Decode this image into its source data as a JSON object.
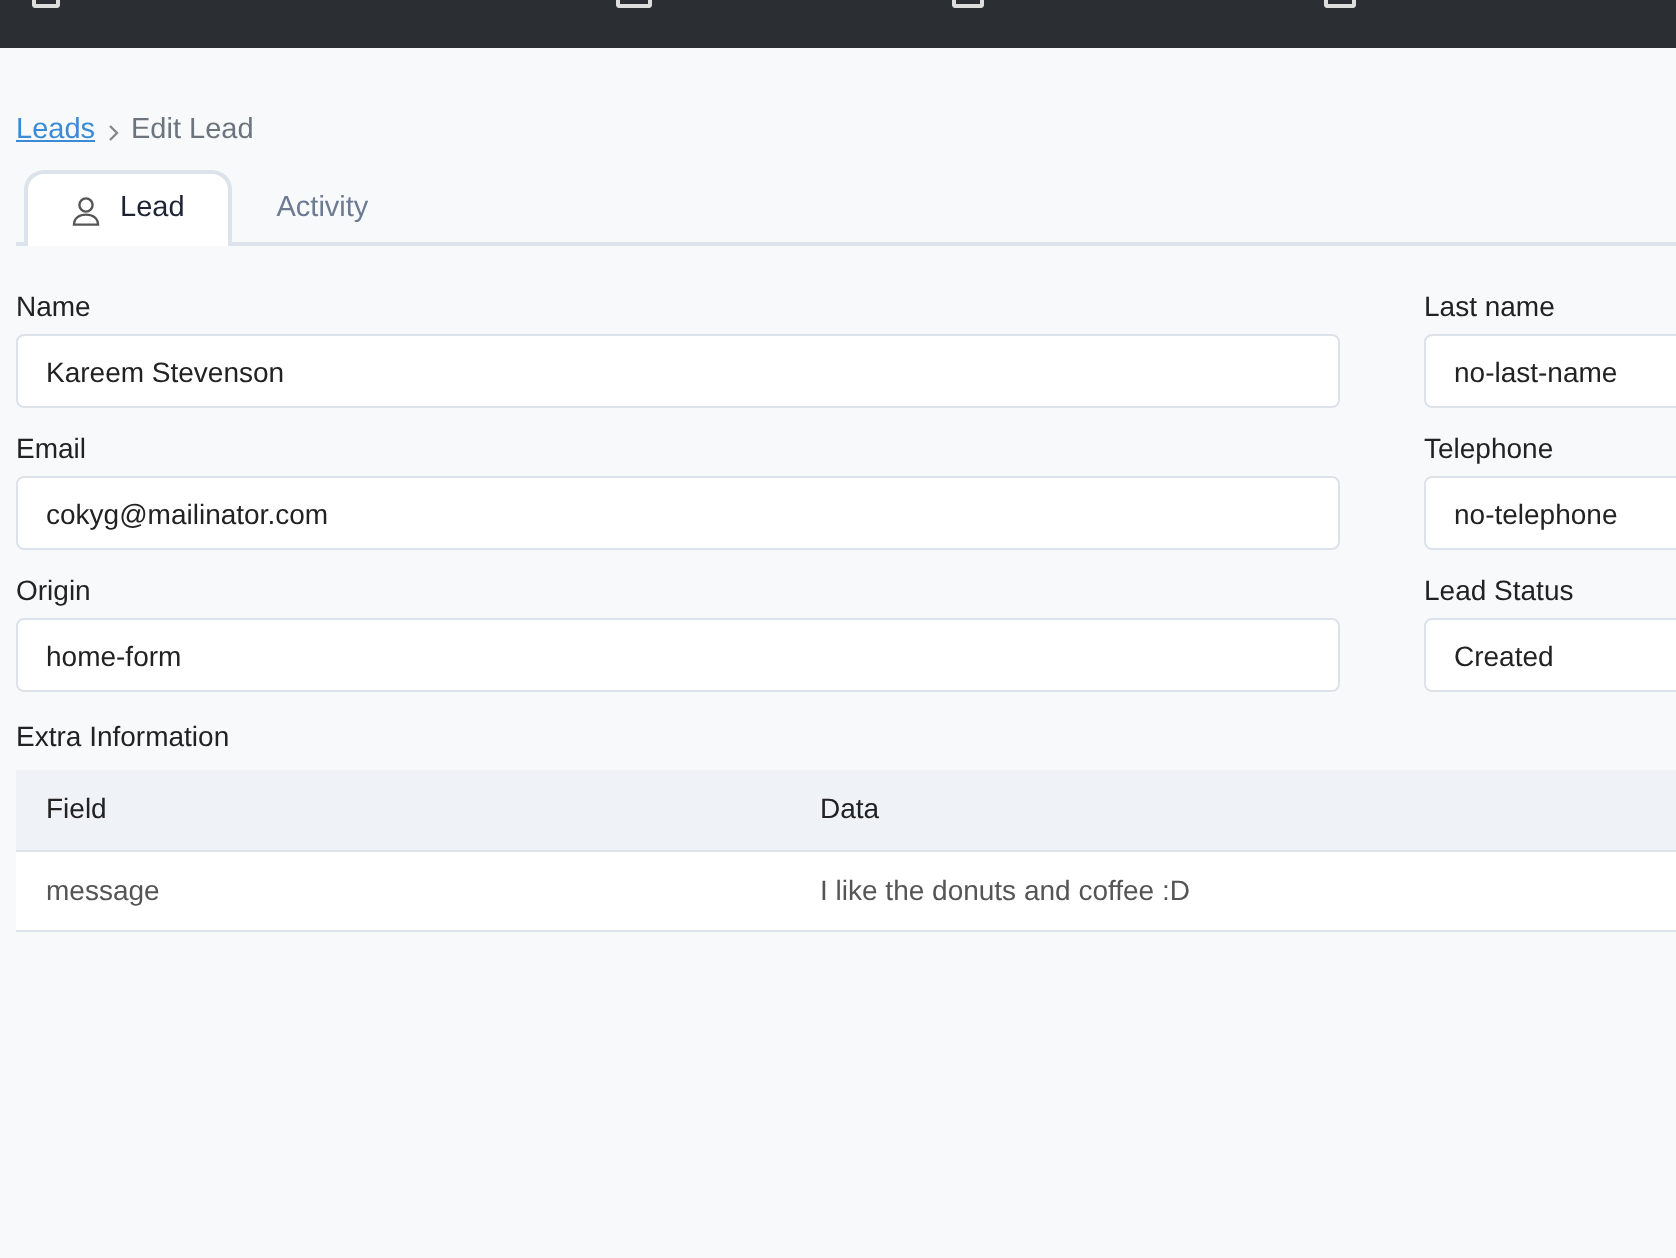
{
  "breadcrumb": [
    {
      "label": "Leads",
      "link": true
    },
    {
      "label": "Edit Lead",
      "link": false
    }
  ],
  "tabs": [
    {
      "label": "Lead",
      "selected": true,
      "kind": "with-icon"
    },
    {
      "label": "Activity",
      "selected": false,
      "kind": "plain"
    }
  ],
  "fields": [
    {
      "label": "Name",
      "value": "Kareem Stevenson"
    },
    {
      "label": "Last name",
      "value": "no-last-name"
    },
    {
      "label": "Email",
      "value": "cokyg@mailinator.com"
    },
    {
      "label": "Telephone",
      "value": "no-telephone"
    },
    {
      "label": "Origin",
      "value": "home-form"
    },
    {
      "label": "Lead Status",
      "value": "Created"
    }
  ],
  "extra_information": {
    "title": "Extra Information",
    "columns": [
      "Field",
      "Data"
    ],
    "rows": [
      [
        "message",
        "I like the donuts and coffee :D"
      ]
    ]
  }
}
